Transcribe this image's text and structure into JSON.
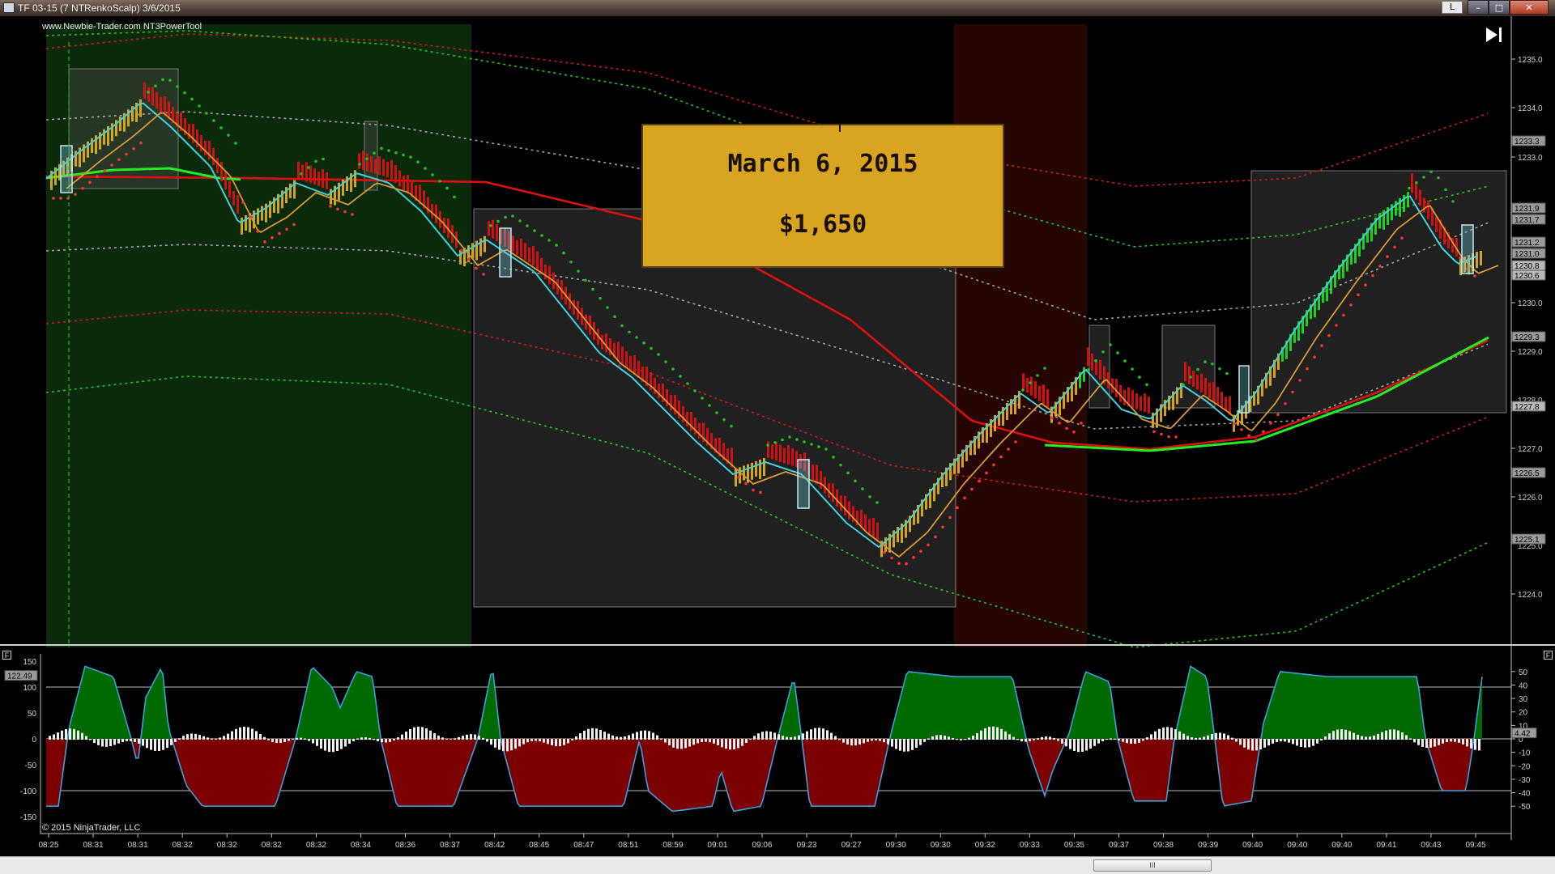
{
  "window": {
    "title": "TF 03-15 (7 NTRenkoScalp)  3/6/2015",
    "controls": [
      "L",
      "–",
      "□",
      "✕"
    ]
  },
  "chart": {
    "watermark": "www.Newbie-Trader.com NT3PowerTool",
    "copyright": "© 2015 NinjaTrader, LLC",
    "annotation": {
      "date": "March 6, 2015",
      "amount": "$1,650"
    },
    "price_ticks": [
      "1235.0",
      "1234.0",
      "1233.0",
      "1230.0",
      "1229.0",
      "1227.0",
      "1226.0",
      "1224.0"
    ],
    "price_ticks_partial": [
      "1228.0",
      "1225.0"
    ],
    "price_flags": [
      "1233.3",
      "1231.9",
      "1231.7",
      "1231.2",
      "1231.0",
      "1230.8",
      "1230.6",
      "1229.3",
      "1227.8",
      "1226.5",
      "1225.1"
    ],
    "price_flag_colors": [
      "#9a9a9a",
      "#9a9a9a",
      "#9a9a9a",
      "#9a9a9a",
      "#9a9a9a",
      "#b8b8b8",
      "#b8b8b8",
      "#9a9a9a",
      "#b8b8b8",
      "#9a9a9a",
      "#9a9a9a"
    ],
    "left_osc_ticks": [
      "150",
      "100",
      "50",
      "0",
      "-50",
      "-100",
      "-150"
    ],
    "left_osc_flag": "122.49",
    "right_osc_ticks": [
      "50",
      "40",
      "30",
      "20",
      "10",
      "0",
      "-10",
      "-20",
      "-30",
      "-40",
      "-50"
    ],
    "right_osc_flag": "4.42",
    "time_ticks": [
      "08:25",
      "08:31",
      "08:31",
      "08:32",
      "08:32",
      "08:32",
      "08:32",
      "08:34",
      "08:36",
      "08:37",
      "08:42",
      "08:45",
      "08:47",
      "08:51",
      "08:59",
      "09:01",
      "09:06",
      "09:23",
      "09:27",
      "09:30",
      "09:30",
      "09:32",
      "09:33",
      "09:35",
      "09:37",
      "09:38",
      "09:39",
      "09:40",
      "09:40",
      "09:40",
      "09:41",
      "09:43",
      "09:45"
    ],
    "f_button": "F",
    "scroll_grip": "III",
    "colors": {
      "background": "#000000",
      "up_bar": "#e0b020",
      "down_bar": "#e01010",
      "strong_up_bar": "#22dd22",
      "osc_green": "#006a00",
      "osc_red": "#7d0000",
      "ema_cyan": "#40d0e0",
      "ema_orange": "#d89a30",
      "ma_red": "#dd1010",
      "ma_green": "#22ee22",
      "band_green": "#20c020",
      "band_red": "#d01818",
      "band_gray": "#a0a0a0"
    }
  }
}
